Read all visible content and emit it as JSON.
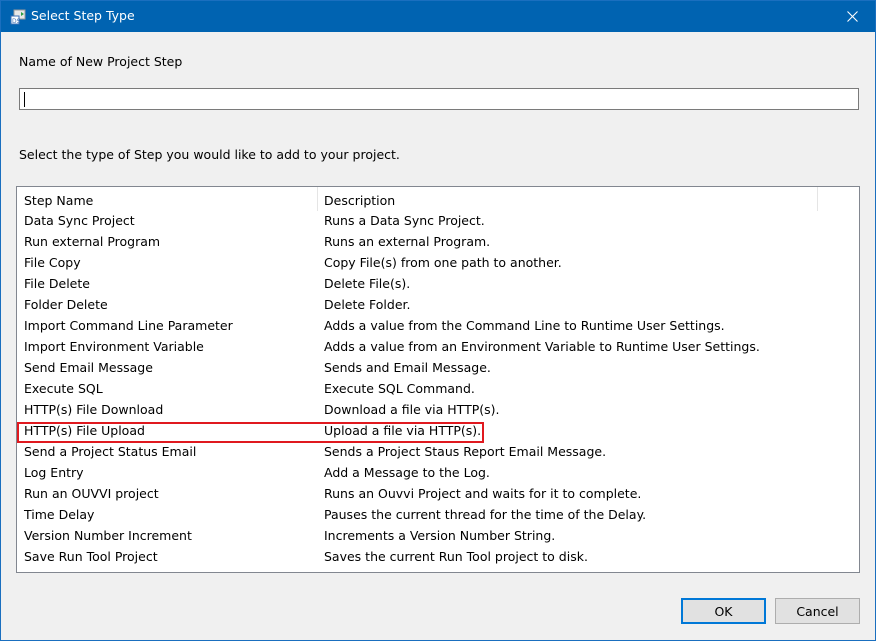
{
  "window": {
    "title": "Select Step Type",
    "app_icon": "app-icon",
    "close_icon": "close-icon"
  },
  "form": {
    "name_label": "Name of New Project Step",
    "name_value": "",
    "select_label": "Select the type of Step you would like to add to your project."
  },
  "list": {
    "columns": [
      "Step Name",
      "Description"
    ],
    "highlighted_index": 10,
    "rows": [
      {
        "name": "Data Sync Project",
        "description": "Runs a Data Sync Project."
      },
      {
        "name": "Run external Program",
        "description": "Runs an external Program."
      },
      {
        "name": "File Copy",
        "description": "Copy File(s) from one path to another."
      },
      {
        "name": "File Delete",
        "description": "Delete File(s)."
      },
      {
        "name": "Folder Delete",
        "description": "Delete Folder."
      },
      {
        "name": "Import Command Line Parameter",
        "description": "Adds a value from the Command Line to Runtime User Settings."
      },
      {
        "name": "Import Environment Variable",
        "description": "Adds a value from an Environment Variable to Runtime User Settings."
      },
      {
        "name": "Send Email Message",
        "description": "Sends and Email Message."
      },
      {
        "name": "Execute SQL",
        "description": "Execute SQL Command."
      },
      {
        "name": "HTTP(s) File Download",
        "description": "Download a file via HTTP(s)."
      },
      {
        "name": "HTTP(s) File Upload",
        "description": "Upload a file via HTTP(s)."
      },
      {
        "name": "Send a Project Status Email",
        "description": "Sends a Project Staus Report Email Message."
      },
      {
        "name": "Log Entry",
        "description": "Add a Message to the Log."
      },
      {
        "name": "Run an OUVVI project",
        "description": "Runs an Ouvvi Project and waits for it to complete."
      },
      {
        "name": "Time Delay",
        "description": "Pauses the current thread for the time of the Delay."
      },
      {
        "name": "Version Number Increment",
        "description": "Increments a Version Number String."
      },
      {
        "name": "Save Run Tool Project",
        "description": "Saves the current Run Tool project to disk."
      }
    ]
  },
  "buttons": {
    "ok": "OK",
    "cancel": "Cancel"
  },
  "colors": {
    "titlebar": "#0063b1",
    "highlight_border": "#e0191f",
    "default_button_border": "#0078d7"
  }
}
